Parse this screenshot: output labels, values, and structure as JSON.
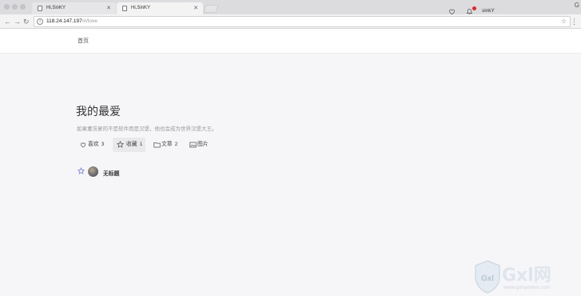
{
  "browser": {
    "tabs": [
      {
        "title": "Hi,SinKY",
        "active": false
      },
      {
        "title": "Hi,SinKY",
        "active": true
      }
    ],
    "url_host": "118.24.147.197",
    "url_path": "/#/love",
    "corner_glyph": "G"
  },
  "header": {
    "home_label": "首页",
    "username": "sinkY",
    "has_notification": true,
    "notification_color": "#e0242c"
  },
  "page": {
    "title": "我的最爱",
    "subtitle": "如果董茨宴的不是软件而是汉堡，他也会成为世界汉堡大王。",
    "tabs": [
      {
        "label": "喜欢",
        "count": "3",
        "icon": "heart-icon",
        "active": false
      },
      {
        "label": "收藏",
        "count": "1",
        "icon": "star-icon",
        "active": true
      },
      {
        "label": "文章",
        "count": "2",
        "icon": "folder-icon",
        "active": false
      },
      {
        "label": "图片",
        "count": "",
        "icon": "image-icon",
        "active": false
      }
    ],
    "items": [
      {
        "title": "无标题",
        "icon": "star-icon"
      }
    ]
  },
  "watermark": {
    "brand": "Gxl网",
    "domain": "www.gxlsystem.com"
  },
  "colors": {
    "background": "#f6f6f8",
    "header_bg": "#ffffff",
    "active_tab_bg": "#e9e9ec",
    "star_accent": "#6b7bd8"
  }
}
